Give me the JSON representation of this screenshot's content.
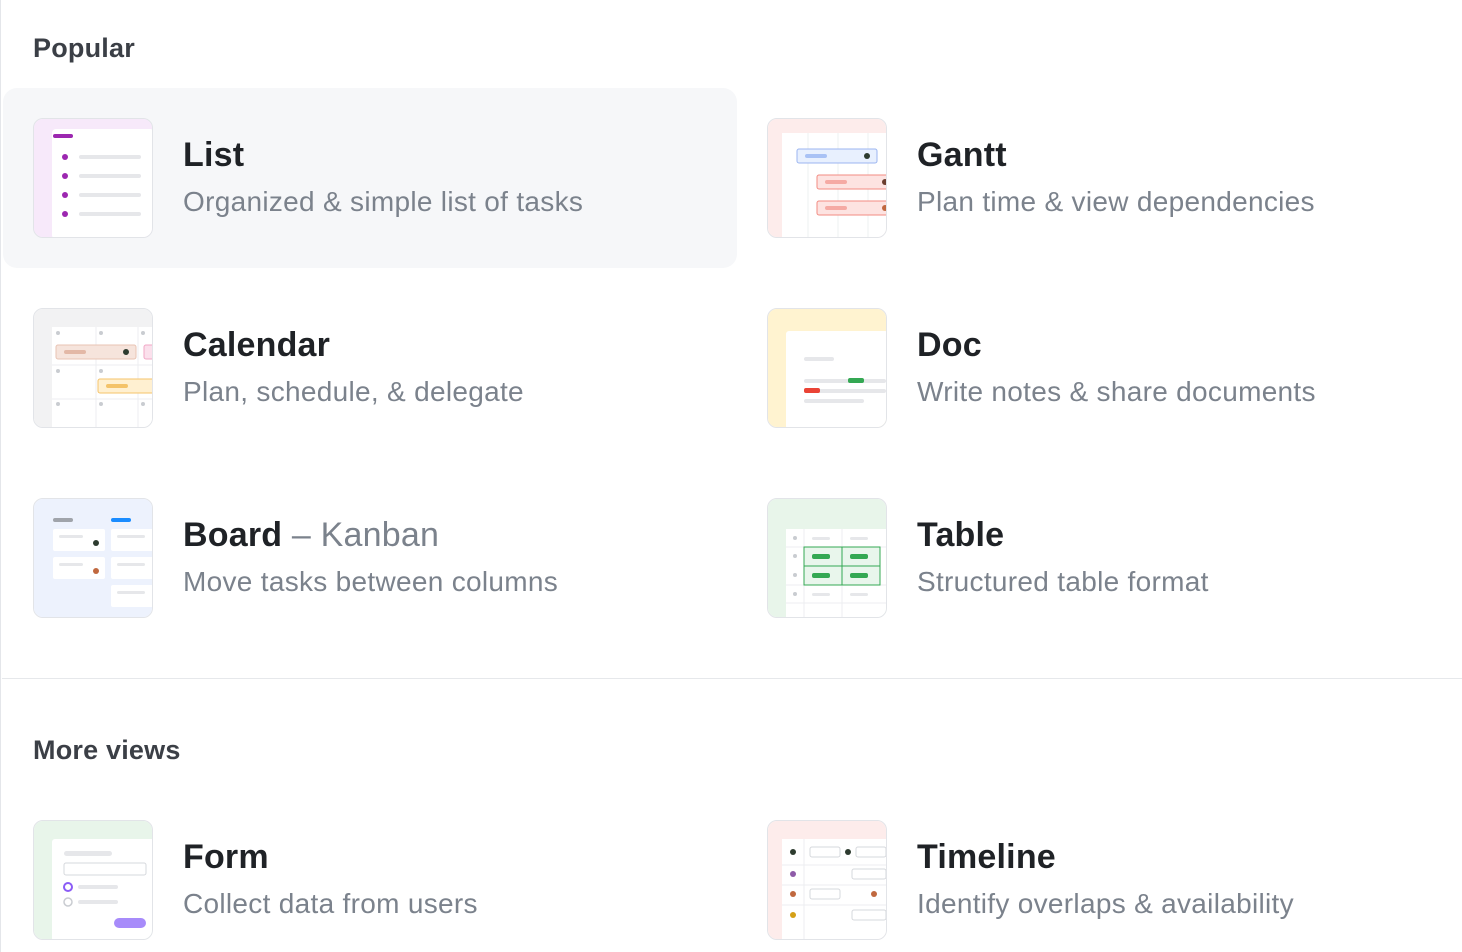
{
  "sections": {
    "popular": {
      "title": "Popular"
    },
    "more": {
      "title": "More views"
    }
  },
  "views": {
    "list": {
      "name": "List",
      "description": "Organized & simple list of tasks",
      "icon": "list-view-icon",
      "accent": "#9c27b0"
    },
    "gantt": {
      "name": "Gantt",
      "description": "Plan time & view dependencies",
      "icon": "gantt-view-icon",
      "accent": "#f28b82"
    },
    "calendar": {
      "name": "Calendar",
      "description": "Plan, schedule, & delegate",
      "icon": "calendar-view-icon",
      "accent": "#f4b04f"
    },
    "doc": {
      "name": "Doc",
      "description": "Write notes & share documents",
      "icon": "doc-view-icon",
      "accent": "#fbbc04"
    },
    "board": {
      "name": "Board",
      "subtitle": "– Kanban",
      "description": "Move tasks between columns",
      "icon": "board-view-icon",
      "accent": "#1a8cff"
    },
    "table": {
      "name": "Table",
      "description": "Structured table format",
      "icon": "table-view-icon",
      "accent": "#34a853"
    },
    "form": {
      "name": "Form",
      "description": "Collect data from users",
      "icon": "form-view-icon",
      "accent": "#a78bfa"
    },
    "timeline": {
      "name": "Timeline",
      "description": "Identify overlaps & availability",
      "icon": "timeline-view-icon",
      "accent": "#f28b82"
    }
  }
}
